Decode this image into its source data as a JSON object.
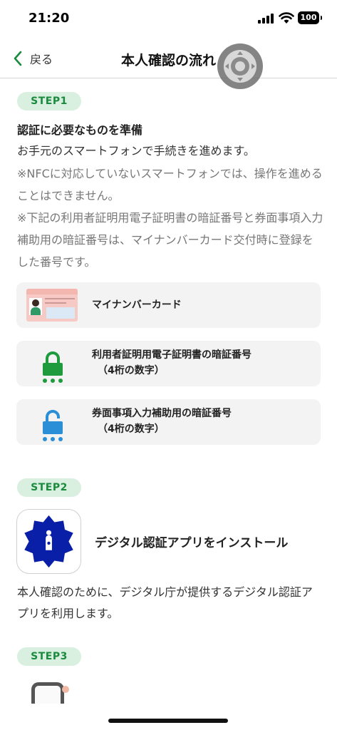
{
  "status_bar": {
    "time": "21:20",
    "battery": "100"
  },
  "nav": {
    "back_label": "戻る",
    "title": "本人確認の流れ"
  },
  "step1": {
    "badge": "STEP1",
    "heading": "認証に必要なものを準備",
    "description": "お手元のスマートフォンで手続きを進めます。",
    "note1": "※NFCに対応していないスマートフォンでは、操作を進めることはできません。",
    "note2": "※下記の利用者証明用電子証明書の暗証番号と券面事項入力補助用の暗証番号は、マイナンバーカード交付時に登録をした番号です。",
    "items": [
      {
        "icon": "my-number-card-icon",
        "label": "マイナンバーカード",
        "sub": ""
      },
      {
        "icon": "green-lock-icon",
        "label": "利用者証明用電子証明書の暗証番号",
        "sub": "（4桁の数字）"
      },
      {
        "icon": "blue-lock-icon",
        "label": "券面事項入力補助用の暗証番号",
        "sub": "（4桁の数字）"
      }
    ]
  },
  "step2": {
    "badge": "STEP2",
    "app_title": "デジタル認証アプリをインストール",
    "description": "本人確認のために、デジタル庁が提供するデジタル認証アプリを利用します。"
  },
  "step3": {
    "badge": "STEP3"
  },
  "colors": {
    "accent": "#1a8a3e",
    "badge_bg": "#d9f0e0",
    "green_lock": "#1f9a3c",
    "blue_lock": "#2a8fd6",
    "app_blue": "#0a1fa8"
  }
}
